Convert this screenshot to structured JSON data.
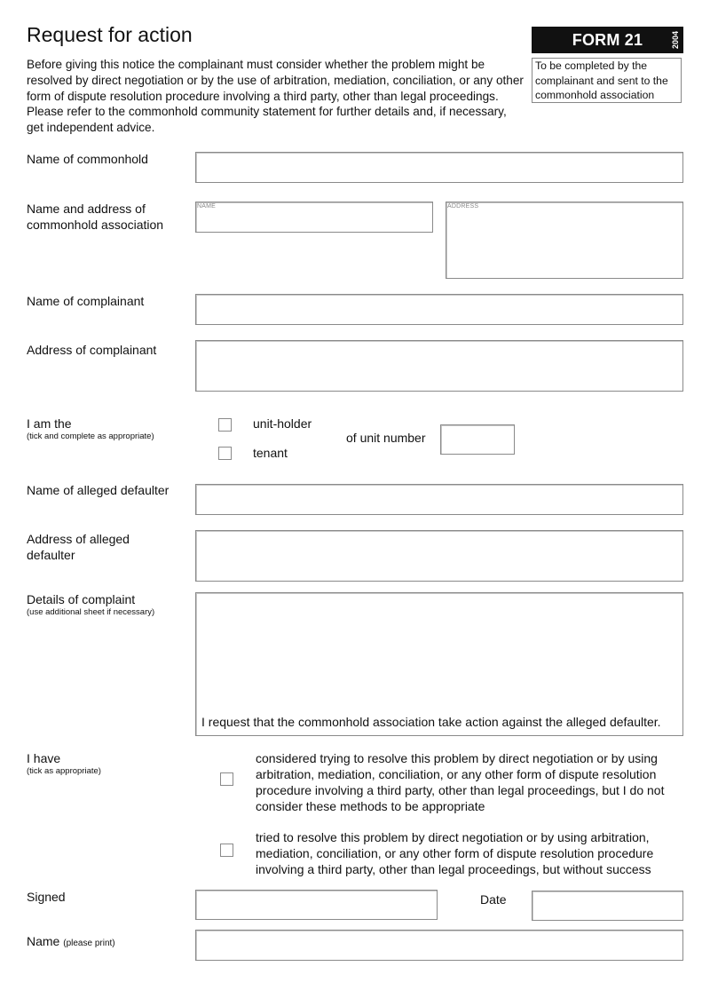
{
  "header": {
    "title": "Request for action",
    "intro": "Before giving this notice the complainant must consider whether the problem might be resolved by direct negotiation or by the use of arbitration, mediation, conciliation, or any other form of dispute resolution procedure involving a third party, other than legal proceedings. Please refer to the commonhold community statement for further details and, if necessary, get independent advice.",
    "form_number": "FORM 21",
    "form_year": "2004",
    "completion_note": "To be completed by the complainant and sent to the commonhold association"
  },
  "fields": {
    "commonhold_name": {
      "label": "Name of commonhold",
      "value": ""
    },
    "association": {
      "label": "Name and address of commonhold association",
      "name_placeholder": "NAME",
      "address_placeholder": "ADDRESS",
      "name_value": "",
      "address_value": ""
    },
    "complainant_name": {
      "label": "Name of complainant",
      "value": ""
    },
    "complainant_address": {
      "label": "Address of complainant",
      "value": ""
    },
    "role": {
      "label": "I am the",
      "hint": "(tick and complete as appropriate)",
      "options": [
        {
          "label": "unit-holder",
          "checked": false
        },
        {
          "label": "tenant",
          "checked": false
        }
      ],
      "unit_number_label": "of unit number",
      "unit_number_value": ""
    },
    "defaulter_name": {
      "label": "Name of alleged defaulter",
      "value": ""
    },
    "defaulter_address": {
      "label": "Address of alleged defaulter",
      "value": ""
    },
    "complaint": {
      "label": "Details of complaint",
      "hint": "(use additional sheet if necessary)",
      "value": "",
      "statement": "I request that the commonhold association take action against the alleged defaulter."
    },
    "attempts": {
      "label": "I have",
      "hint": "(tick as appropriate)",
      "options": [
        {
          "label": "considered trying to resolve this problem by direct negotiation or by using arbitration, mediation, conciliation, or any other form of dispute resolution procedure involving a third party, other than legal proceedings, but I do not consider these methods to be appropriate",
          "checked": false
        },
        {
          "label": "tried to resolve this problem by direct negotiation or by using arbitration, mediation, conciliation, or any other form of dispute resolution procedure involving a third party, other than legal proceedings, but without success",
          "checked": false
        }
      ]
    },
    "signed": {
      "label": "Signed",
      "value": ""
    },
    "date": {
      "label": "Date",
      "value": ""
    },
    "print_name": {
      "label": "Name",
      "hint": "(please print)",
      "value": ""
    }
  }
}
